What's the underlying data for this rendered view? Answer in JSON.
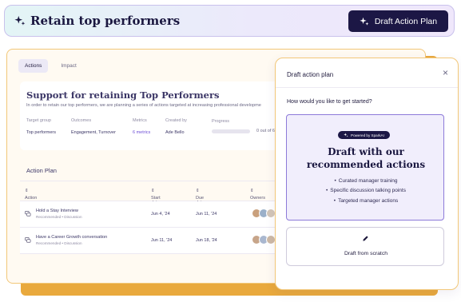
{
  "header": {
    "title": "Retain top performers",
    "action_button": "Draft Action Plan"
  },
  "tabs": [
    {
      "label": "Actions",
      "active": true
    },
    {
      "label": "Impact",
      "active": false
    }
  ],
  "summary": {
    "title": "Support for retaining Top Performers",
    "description": "In order to retain our top performers, we are planning a series of actions targeted at increasing professional developme",
    "fields": [
      {
        "label": "Target group",
        "value": "Top performers"
      },
      {
        "label": "Outcomes",
        "value": "Engagement, Turnover"
      },
      {
        "label": "Metrics",
        "value": "6 metrics"
      },
      {
        "label": "Created by",
        "value": "Ade Bello"
      }
    ],
    "progress_label": "Progress",
    "progress_text": "0 out of 60 a",
    "progress_fraction": 0
  },
  "action_plan": {
    "title": "Action Plan",
    "columns": [
      "Action",
      "Start date",
      "Due date",
      "Owners"
    ],
    "rows": [
      {
        "name": "Hold a Stay Interview",
        "tag": "Recommended • Discussion",
        "start": "Jun 4, '24",
        "due": "Jun 11, '24"
      },
      {
        "name": "Have a Career Growth conversation",
        "tag": "Recommended • Discussion",
        "start": "Jun 11, '24",
        "due": "Jun 18, '24"
      }
    ]
  },
  "panel": {
    "title": "Draft action plan",
    "close": "×",
    "question": "How would you like to get started?",
    "recommended": {
      "badge": "Powered by SparkAI",
      "heading_line1": "Draft with our",
      "heading_line2": "recommended actions",
      "items": [
        "Curated manager training",
        "Specific discussion talking points",
        "Targeted manager actions"
      ]
    },
    "scratch_label": "Draft from scratch"
  },
  "colors": {
    "brand_dark": "#1c1745",
    "accent_purple": "#6e4fd6",
    "accent_orange": "#e9a93d"
  }
}
